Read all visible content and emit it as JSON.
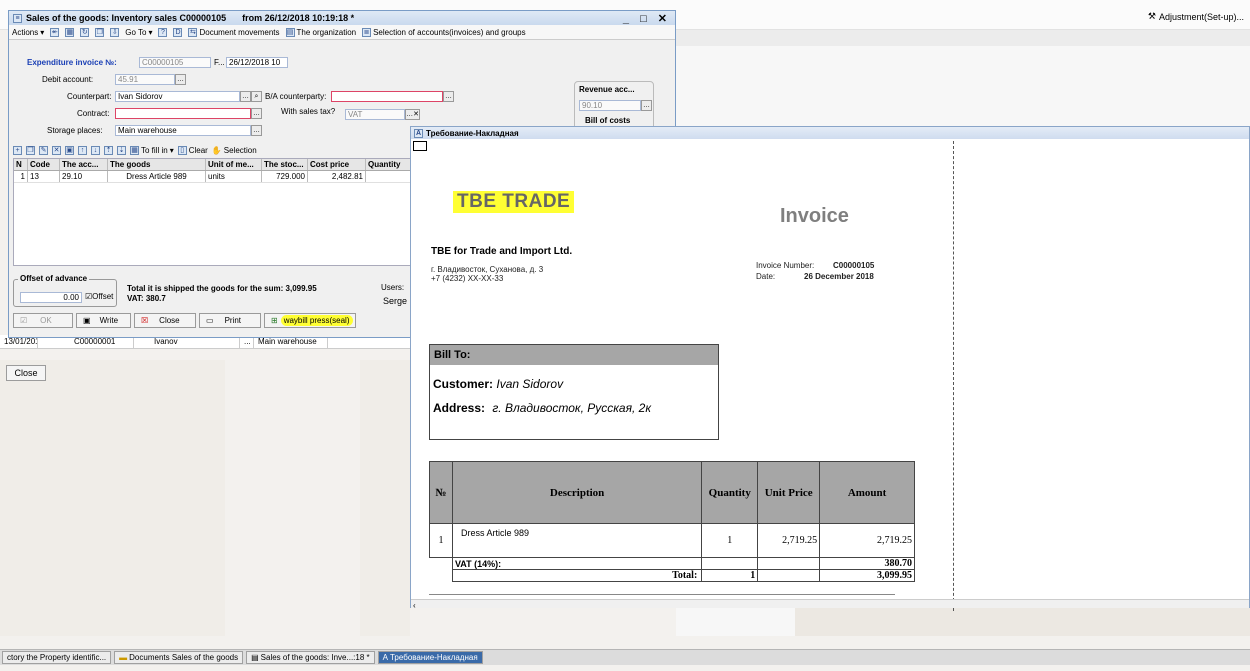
{
  "app": {
    "adjustment_label": "Adjustment(Set-up)...",
    "close_label": "Close",
    "bg_row": [
      "13/01/201...",
      "C00000001",
      "Ivanov",
      "...",
      "Main warehouse"
    ]
  },
  "sales_window": {
    "title": "Sales of the goods: Inventory sales C00000105",
    "title_date": "from 26/12/2018 10:19:18 *",
    "toolbar": {
      "actions": "Actions",
      "goto": "Go To",
      "doc_movements": "Document movements",
      "organization": "The organization",
      "selection_accounts": "Selection of accounts(invoices) and groups"
    },
    "form": {
      "expenditure_label": "Expenditure invoice №:",
      "invoice_number": "C00000105",
      "f_label": "F...",
      "invoice_date": "26/12/2018 10",
      "debit_label": "Debit account:",
      "debit_value": "45.91",
      "counterpart_label": "Counterpart:",
      "counterpart_value": "Ivan Sidorov",
      "ba_label": "B/A counterparty:",
      "contract_label": "Contract:",
      "sales_tax_label": "With sales tax?",
      "sales_tax_value": "VAT",
      "storage_label": "Storage places:",
      "storage_value": "Main warehouse",
      "revenue_label": "Revenue acc...",
      "revenue_value": "90.10",
      "bill_costs_label": "Bill of costs"
    },
    "grid_toolbar": {
      "fill_in": "To fill in",
      "clear": "Clear",
      "selection": "Selection"
    },
    "grid_columns": [
      "N",
      "Code",
      "The acc...",
      "The goods",
      "Unit of me...",
      "The stoc...",
      "Cost price",
      "Quantity"
    ],
    "grid_rows": [
      [
        "1",
        "13",
        "29.10",
        "Dress Article 989",
        "units",
        "729.000",
        "2,482.81",
        ""
      ]
    ],
    "footer": {
      "advance_label": "Offset of advance",
      "advance_value": "0.00",
      "offset_label": "Offset",
      "shipped_label": "Total it is shipped the goods for the sum: 3,099.95",
      "vat_label": "VAT: 380.7",
      "users_label": "Users:",
      "user_value": "Serge"
    },
    "buttons": {
      "ok": "OK",
      "write": "Write",
      "close": "Close",
      "print": "Print",
      "waybill": "waybill press(seal)"
    }
  },
  "invoice_window": {
    "title": "Требование-Накладная",
    "brand": "TBE TRADE",
    "heading": "Invoice",
    "company": "TBE for Trade and Import Ltd.",
    "address_line": "г. Владивосток, Суханова, д. 3",
    "phone_line": "+7 (4232) XX-XX-33",
    "invoice_number_label": "Invoice Number:",
    "invoice_number": "C00000105",
    "date_label": "Date:",
    "date_value": "26 December 2018",
    "bill_to": "Bill To:",
    "customer_label": "Customer:",
    "customer_value": "Ivan Sidorov",
    "address_label": "Address:",
    "address_value": "г. Владивосток, Русская, 2к",
    "table_headers": [
      "№",
      "Description",
      "Quantity",
      "Unit Price",
      "Amount"
    ],
    "items": [
      {
        "n": "1",
        "description": "Dress Article 989",
        "quantity": "1",
        "unit_price": "2,719.25",
        "amount": "2,719.25"
      }
    ],
    "vat_label": "VAT (14%):",
    "vat_amount": "380.70",
    "total_label": "Total:",
    "total_quantity": "1",
    "total_amount": "3,099.95"
  },
  "taskbar": {
    "items": [
      "ctory the Property identific...",
      "Documents Sales of the goods",
      "Sales of the goods: Inve...:18 *",
      "Требование-Накладная"
    ]
  },
  "colors": {
    "highlight": "#ffff33",
    "header_gray": "#a6a6a6",
    "window_border": "#7a9cc6"
  }
}
